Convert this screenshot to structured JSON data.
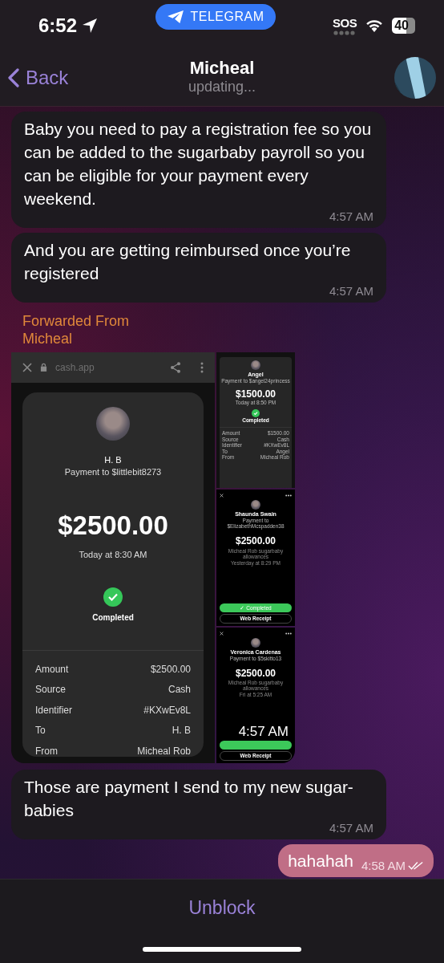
{
  "status_bar": {
    "time": "6:52",
    "app_pill": "TELEGRAM",
    "sos": "SOS",
    "battery": "40"
  },
  "header": {
    "back": "Back",
    "title": "Micheal",
    "subtitle": "updating..."
  },
  "messages": [
    {
      "kind": "text",
      "outgoing": false,
      "text": "Baby you need to pay a registration fee so you can be added to the sugarbaby payroll so you can be eligible for your payment every weekend.",
      "time": "4:57 AM"
    },
    {
      "kind": "text",
      "outgoing": false,
      "text": "And you are getting reimbursed once you’re registered",
      "time": "4:57 AM"
    },
    {
      "kind": "media",
      "outgoing": false,
      "forwarded_label": "Forwarded From",
      "forwarded_name": "Micheal",
      "time": "4:57 AM",
      "main": {
        "url": "cash.app",
        "name": "H. B",
        "payment_to": "Payment to $littlebit8273",
        "amount": "$2500.00",
        "date": "Today at 8:30 AM",
        "status": "Completed",
        "details": [
          {
            "label": "Amount",
            "value": "$2500.00"
          },
          {
            "label": "Source",
            "value": "Cash"
          },
          {
            "label": "Identifier",
            "value": "#KXwEv8L"
          },
          {
            "label": "To",
            "value": "H. B"
          },
          {
            "label": "From",
            "value": "Micheal Rob"
          }
        ]
      },
      "thumbnails": [
        {
          "kind": "card",
          "name": "Angel",
          "payment_to": "Payment to $angel24princess",
          "amount": "$1500.00",
          "date": "Today at 8:50 PM",
          "status": "Completed",
          "details": [
            {
              "label": "Amount",
              "value": "$1500.00"
            },
            {
              "label": "Source",
              "value": "Cash"
            },
            {
              "label": "Identifier",
              "value": "#KXwEv8L"
            },
            {
              "label": "To",
              "value": "Angel"
            },
            {
              "label": "From",
              "value": "Micheal Rob"
            }
          ]
        },
        {
          "kind": "sheet",
          "name": "Shaunda Swain",
          "payment_to": "Payment to $ElizabethMcspadden38",
          "amount": "$2500.00",
          "note": "Micheal Rob sugarbaby allowances",
          "date": "Yesterday at 8:29 PM",
          "status": "✓ Completed",
          "receipt": "Web Receipt"
        },
        {
          "kind": "sheet",
          "name": "Veronica Cardenas",
          "payment_to": "Payment to $5skitto13",
          "amount": "$2500.00",
          "note": "Micheal Rob sugarbaby allowances",
          "date": "Fri at 5:25 AM",
          "receipt": "Web Receipt"
        }
      ]
    },
    {
      "kind": "text",
      "outgoing": false,
      "text": "Those are payment I send to my new sugar-babies",
      "time": "4:57 AM"
    },
    {
      "kind": "text",
      "outgoing": true,
      "text": "hahahah",
      "time": "4:58 AM",
      "read": true
    }
  ],
  "footer": {
    "action": "Unblock"
  }
}
